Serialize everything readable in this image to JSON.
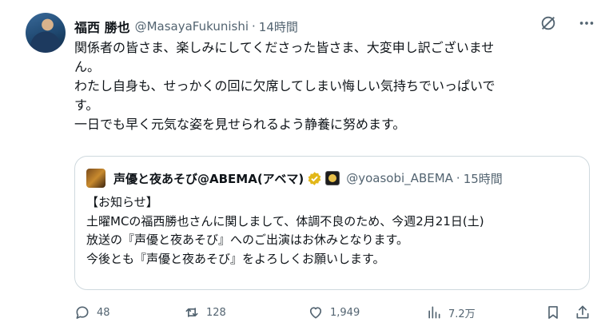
{
  "tweet": {
    "author": {
      "display_name": "福西 勝也",
      "handle": "@MasayaFukunishi",
      "separator": "·",
      "time": "14時間"
    },
    "body_lines": [
      "関係者の皆さま、楽しみにしてくださった皆さま、大変申し訳ございませ",
      "ん。",
      "わたし自身も、せっかくの回に欠席してしまい悔しい気持ちでいっぱいで",
      "す。",
      "一日でも早く元気な姿を見せられるよう静養に努めます。"
    ],
    "quote": {
      "display_name": "声優と夜あそび@ABEMA(アベマ)",
      "handle": "@yoasobi_ABEMA",
      "separator": "·",
      "time": "15時間",
      "body_lines": [
        "【お知らせ】",
        "土曜MCの福西勝也さんに関しまして、体調不良のため、今週2月21日(土)",
        "放送の『声優と夜あそび』へのご出演はお休みとなります。",
        "今後とも『声優と夜あそび』をよろしくお願いします。"
      ]
    },
    "stats": {
      "replies": "48",
      "reposts": "128",
      "likes": "1,949",
      "views": "7.2万"
    }
  },
  "icons": {
    "grok": "grok-icon",
    "more": "more-icon",
    "verified": "verified-gold-badge-icon",
    "reply": "reply-icon",
    "repost": "repost-icon",
    "like": "heart-icon",
    "views": "views-icon",
    "bookmark": "bookmark-icon",
    "share": "share-icon"
  },
  "colors": {
    "text_primary": "#0f1419",
    "text_secondary": "#536471",
    "border": "#cfd9de",
    "verified_gold": "#e2b719"
  }
}
